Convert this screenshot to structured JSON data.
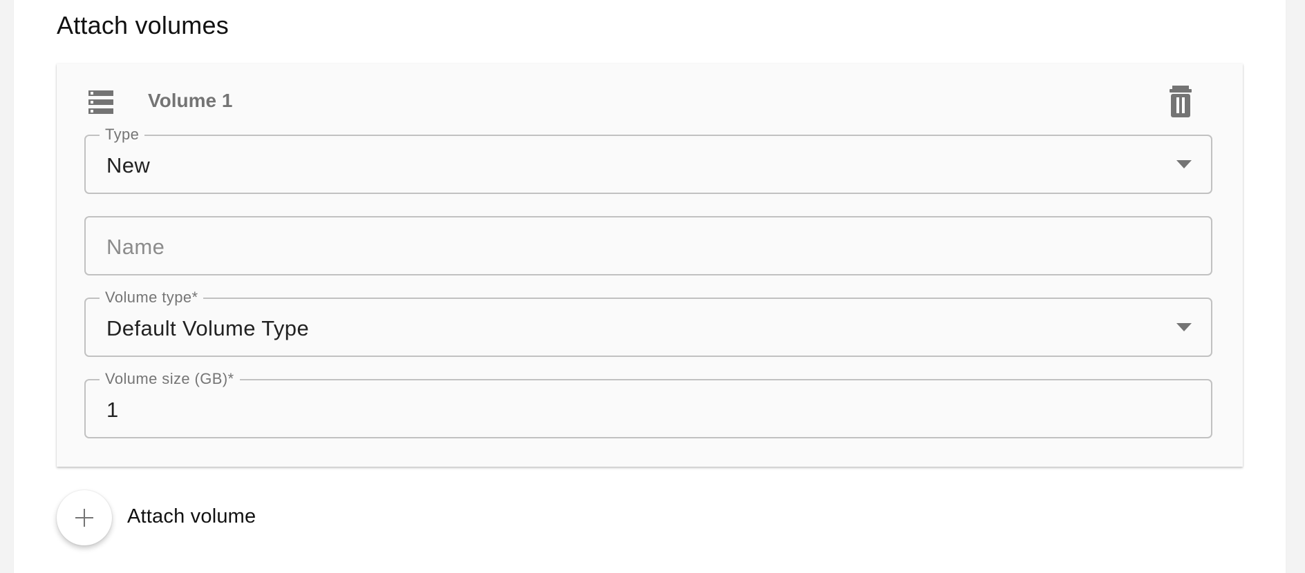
{
  "section": {
    "title": "Attach volumes"
  },
  "volume_card": {
    "title": "Volume 1",
    "icons": {
      "volume": "storage-icon",
      "delete": "trash-icon"
    },
    "fields": {
      "type": {
        "label": "Type",
        "value": "New"
      },
      "name": {
        "placeholder": "Name",
        "value": ""
      },
      "volume_type": {
        "label": "Volume type*",
        "value": "Default Volume Type"
      },
      "volume_size": {
        "label": "Volume size (GB)*",
        "value": "1"
      }
    }
  },
  "actions": {
    "attach_volume": "Attach volume",
    "attach_volume_icon": "plus-icon"
  },
  "colors": {
    "page_background": "#f3f3f3",
    "panel_background": "#ffffff",
    "card_background": "#fafafa",
    "border": "#c1c1c1",
    "icon_gray": "#747474",
    "text_primary": "#222222",
    "text_secondary": "#757575"
  }
}
